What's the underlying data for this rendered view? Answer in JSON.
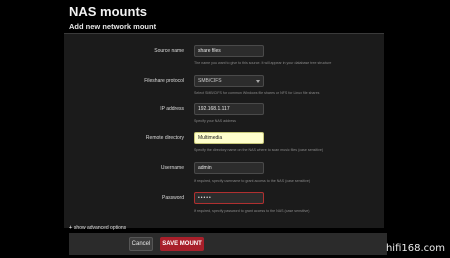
{
  "page": {
    "title": "NAS mounts",
    "subtitle": "Add new network mount"
  },
  "form": {
    "source_name": {
      "label": "Source name",
      "value": "share files",
      "help": "The name you want to give to this source. It will appear in your database tree structure"
    },
    "fileshare_protocol": {
      "label": "Fileshare protocol",
      "value": "SMB/CIFS",
      "help": "Select SMB/CIFS for common Windows file shares or NFS for Linux file shares"
    },
    "ip_address": {
      "label": "IP address",
      "value": "192.168.1.117",
      "help": "Specify your NAS address"
    },
    "remote_directory": {
      "label": "Remote directory",
      "value": "Multimedia",
      "help": "Specify the directory name on the NAS where to scan music files (case sensitive)"
    },
    "username": {
      "label": "Username",
      "value": "admin",
      "help": "If required, specify username to grant access to the NAS (case sensitive)"
    },
    "password": {
      "label": "Password",
      "value": "•••••",
      "help": "If required, specify password to grant access to the NAS (case sensitive)"
    }
  },
  "advanced": {
    "plus": "+",
    "label": "show advanced options"
  },
  "buttons": {
    "cancel": "Cancel",
    "save": "SAVE MOUNT"
  },
  "colors": {
    "background": "#000000",
    "panel": "#1b1b1b",
    "save_button": "#a81f2a",
    "highlight_field": "#ffffcc",
    "password_border": "#b03030"
  },
  "watermark": "hifi168.com"
}
